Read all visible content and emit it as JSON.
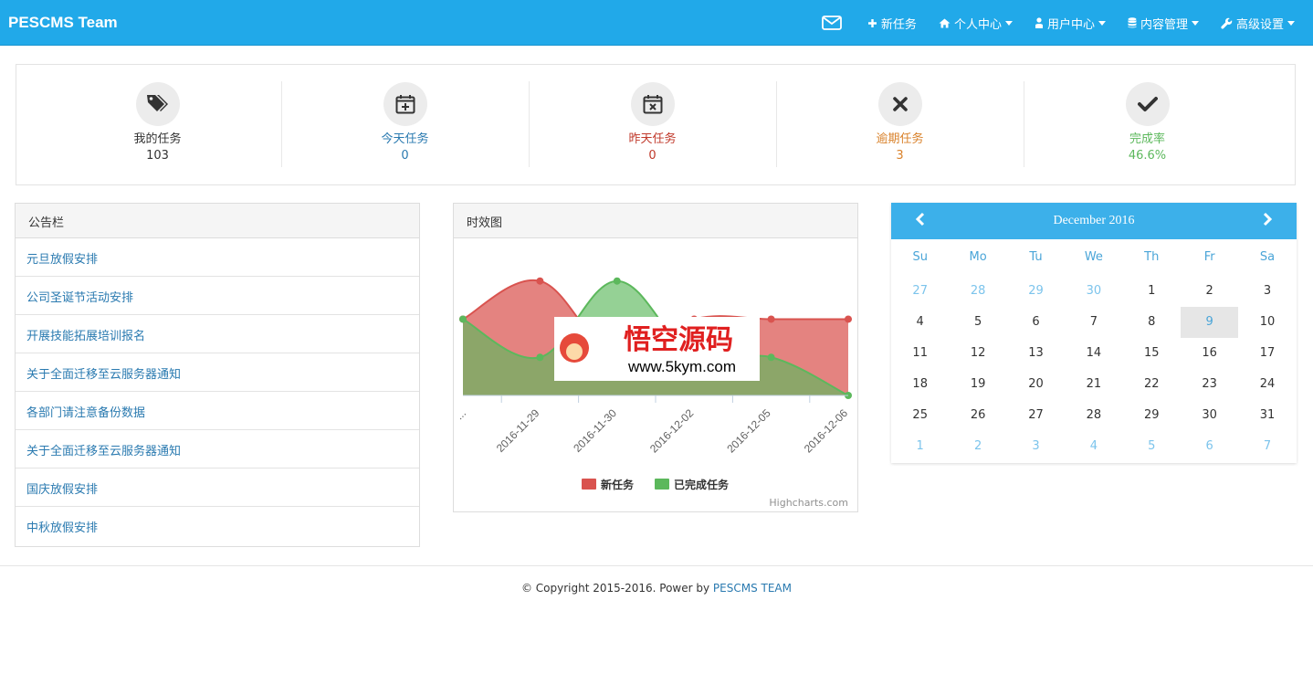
{
  "brand": "PESCMS Team",
  "nav": {
    "mail_icon": "envelope-icon",
    "items": [
      {
        "label": "新任务",
        "icon": "plus-icon",
        "caret": false
      },
      {
        "label": "个人中心",
        "icon": "home-icon",
        "caret": true
      },
      {
        "label": "用户中心",
        "icon": "user-icon",
        "caret": true
      },
      {
        "label": "内容管理",
        "icon": "database-icon",
        "caret": true
      },
      {
        "label": "高级设置",
        "icon": "wrench-icon",
        "caret": true
      }
    ]
  },
  "stats": [
    {
      "label": "我的任务",
      "value": "103",
      "icon": "tags-icon",
      "color": "#333333"
    },
    {
      "label": "今天任务",
      "value": "0",
      "icon": "calendar-plus-icon",
      "color": "#2a7ab0"
    },
    {
      "label": "昨天任务",
      "value": "0",
      "icon": "calendar-x-icon",
      "color": "#c0392b"
    },
    {
      "label": "逾期任务",
      "value": "3",
      "icon": "x-icon",
      "color": "#d9822b"
    },
    {
      "label": "完成率",
      "value": "46.6%",
      "icon": "check-icon",
      "color": "#5cb85c"
    }
  ],
  "notice": {
    "title": "公告栏",
    "items": [
      "元旦放假安排",
      "公司圣诞节活动安排",
      "开展技能拓展培训报名",
      "关于全面迁移至云服务器通知",
      "各部门请注意备份数据",
      "关于全面迁移至云服务器通知",
      "国庆放假安排",
      "中秋放假安排"
    ]
  },
  "chart_panel": {
    "title": "时效图",
    "credit": "Highcharts.com",
    "watermark_line1": "悟空源码",
    "watermark_line2": "www.5kym.com"
  },
  "chart_data": {
    "type": "area",
    "categories": [
      "...",
      "2016-11-29",
      "2016-11-30",
      "2016-12-02",
      "2016-12-05",
      "2016-12-06"
    ],
    "series": [
      {
        "name": "新任务",
        "color": "#d9534f",
        "values": [
          2,
          3,
          1,
          2,
          2,
          2
        ]
      },
      {
        "name": "已完成任务",
        "color": "#5cb85c",
        "values": [
          2,
          1,
          3,
          1,
          1,
          0
        ]
      }
    ],
    "ylim": [
      0,
      3.4
    ],
    "legend_position": "bottom-center"
  },
  "calendar": {
    "title": "December 2016",
    "weekdays": [
      "Su",
      "Mo",
      "Tu",
      "We",
      "Th",
      "Fr",
      "Sa"
    ],
    "weeks": [
      [
        "27",
        "28",
        "29",
        "30",
        "1",
        "2",
        "3"
      ],
      [
        "4",
        "5",
        "6",
        "7",
        "8",
        "9",
        "10"
      ],
      [
        "11",
        "12",
        "13",
        "14",
        "15",
        "16",
        "17"
      ],
      [
        "18",
        "19",
        "20",
        "21",
        "22",
        "23",
        "24"
      ],
      [
        "25",
        "26",
        "27",
        "28",
        "29",
        "30",
        "31"
      ],
      [
        "1",
        "2",
        "3",
        "4",
        "5",
        "6",
        "7"
      ]
    ],
    "today": "9"
  },
  "footer": {
    "text": "© Copyright 2015-2016. Power by ",
    "link": "PESCMS TEAM"
  }
}
